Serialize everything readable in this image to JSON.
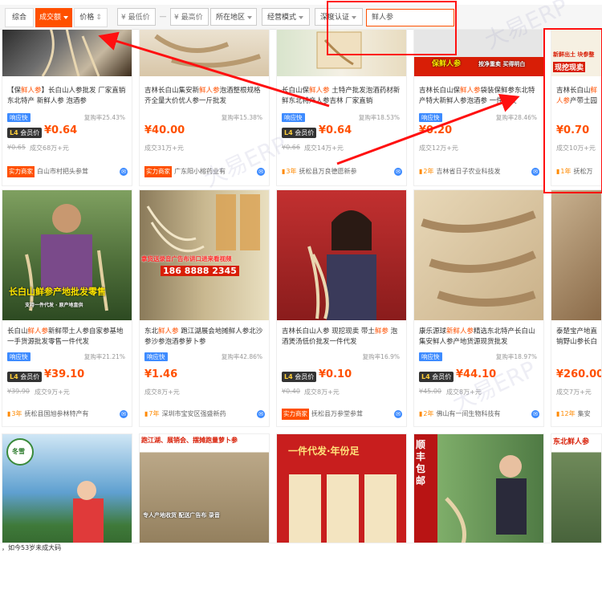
{
  "filters": {
    "all_label": "综合",
    "sales_label": "成交额",
    "price_label": "价格",
    "min_price_placeholder": "¥ 最低价",
    "max_price_placeholder": "¥ 最高价",
    "dash": "—",
    "region_label": "所在地区",
    "mode_label": "经营模式",
    "cert_label": "深度认证",
    "search_value": "鲜人参"
  },
  "accent_color": "#ff5000",
  "cards": [
    {
      "title_pre": "【保",
      "title_hl": "鲜人参",
      "title_post": "】长白山人参批发 厂家直销 东北特产 新鲜人参 泡酒参",
      "resp": "响应快",
      "repurchase": "复购率25.43%",
      "member": "会员价",
      "price": "¥0.64",
      "oldprice": "¥0.65",
      "sold": "成交68万+元",
      "strong": "实力商家",
      "shop": "白山市村把头参茸"
    },
    {
      "title_pre": "吉林长白山集安新",
      "title_hl": "鲜人参",
      "title_post": "泡酒整根规格齐全量大价优人参一斤批发",
      "resp": "",
      "repurchase": "复购率15.38%",
      "member": "",
      "price": "¥40.00",
      "oldprice": "",
      "sold": "成交31万+元",
      "strong": "实力商家",
      "shop": "广东阳小榕药业有"
    },
    {
      "title_pre": "长白山保",
      "title_hl": "鲜人参",
      "title_post": " 土特产批发泡酒药材新鲜东北特产人参吉林 厂家直销",
      "resp": "响应快",
      "repurchase": "复购率18.53%",
      "member": "会员价",
      "price": "¥0.64",
      "oldprice": "¥0.66",
      "sold": "成交14万+元",
      "years": "3年",
      "shop": "抚松县万良德愿新参"
    },
    {
      "title_pre": "吉林长白山保",
      "title_hl": "鲜人参",
      "title_post": "袋装保鲜参东北特产特大新鲜人参泡酒参 一件代发",
      "resp": "响应快",
      "repurchase": "复购率28.46%",
      "member": "",
      "price": "¥0.20",
      "oldprice": "",
      "sold": "成交12万+元",
      "years": "2年",
      "shop": "吉林省日子农业科技发"
    },
    {
      "title_pre": "吉林长白山",
      "title_hl": "鲜人参",
      "title_post": "产带土园参泡酒",
      "resp": "",
      "repurchase": "",
      "member": "",
      "price": "¥0.70",
      "oldprice": "",
      "sold": "成交10万+元",
      "years": "1年",
      "shop": "抚松万"
    },
    {
      "title_pre": "长白山",
      "title_hl": "鲜人参",
      "title_post": "新鲜带土人参自家参基地一手货源批发零售一件代发",
      "resp": "响应快",
      "repurchase": "复购率21.21%",
      "member": "会员价",
      "price": "¥39.10",
      "oldprice": "¥39.90",
      "sold": "成交9万+元",
      "years": "3年",
      "shop": "抚松县国旭参林特产有"
    },
    {
      "title_pre": "东北",
      "title_hl": "鲜人参",
      "title_post": " 跑江湖展会地摊鲜人参北沙参沙参泡酒参萝卜参",
      "resp": "响应快",
      "repurchase": "复购率42.86%",
      "member": "",
      "price": "¥1.46",
      "oldprice": "",
      "sold": "成交8万+元",
      "years": "7年",
      "shop": "深圳市宝安区强盛新药"
    },
    {
      "title_pre": "吉林长白山人参 现挖现卖 带土",
      "title_hl": "鲜参",
      "title_post": " 泡酒煲汤低价批发一件代发",
      "resp": "",
      "repurchase": "复购率16.9%",
      "member": "",
      "price": "¥0.10",
      "oldprice": "¥0.40",
      "sold": "成交8万+元",
      "strong": "实力商家",
      "shop": "抚松县万参堂参茸"
    },
    {
      "title_pre": "康乐源球",
      "title_hl": "新鲜人参",
      "title_post": "精选东北特产长白山集安鲜人参产地货源现货批发",
      "resp": "响应快",
      "repurchase": "复购率18.97%",
      "member": "会员价",
      "price": "¥44.10",
      "oldprice": "¥45.00",
      "sold": "成交8万+元",
      "years": "2年",
      "shop": "佛山有一间生物科技有"
    },
    {
      "title_pre": "泰楚宝产地直销",
      "title_hl": "",
      "title_post": "野山参长白山",
      "resp": "",
      "repurchase": "",
      "member": "",
      "price": "¥260.00",
      "oldprice": "",
      "sold": "成交7万+元",
      "years": "12年",
      "shop": "集安"
    }
  ],
  "overlays": {
    "c1_promo": "保鲜人参",
    "c1_promo2": "按净重卖 买得明白",
    "c2_promo": "新鲜出土 块参整",
    "c2_promo2": "现挖现卖",
    "c6_caption": "长白山鲜参产地批发零售",
    "c6_sub": "支持一件代发 · 原产地直供",
    "c7_banner": "拿货送录音广告布讲口进来看视频",
    "c7_phone": "186 8888 2345",
    "r3_c1": "冬雪",
    "r3_c2": "跑江湖、展销会、摆摊跑量萝卜参",
    "r3_c2b": "专人产地收货 配送广告布 录音",
    "r3_c3": "一件代发·年份足",
    "r3_c4": "顺丰包邮",
    "r3_c5": "东北鲜人参"
  },
  "bottom_note": "，如今53岁未成大码",
  "watermark_text": "大易ERP"
}
